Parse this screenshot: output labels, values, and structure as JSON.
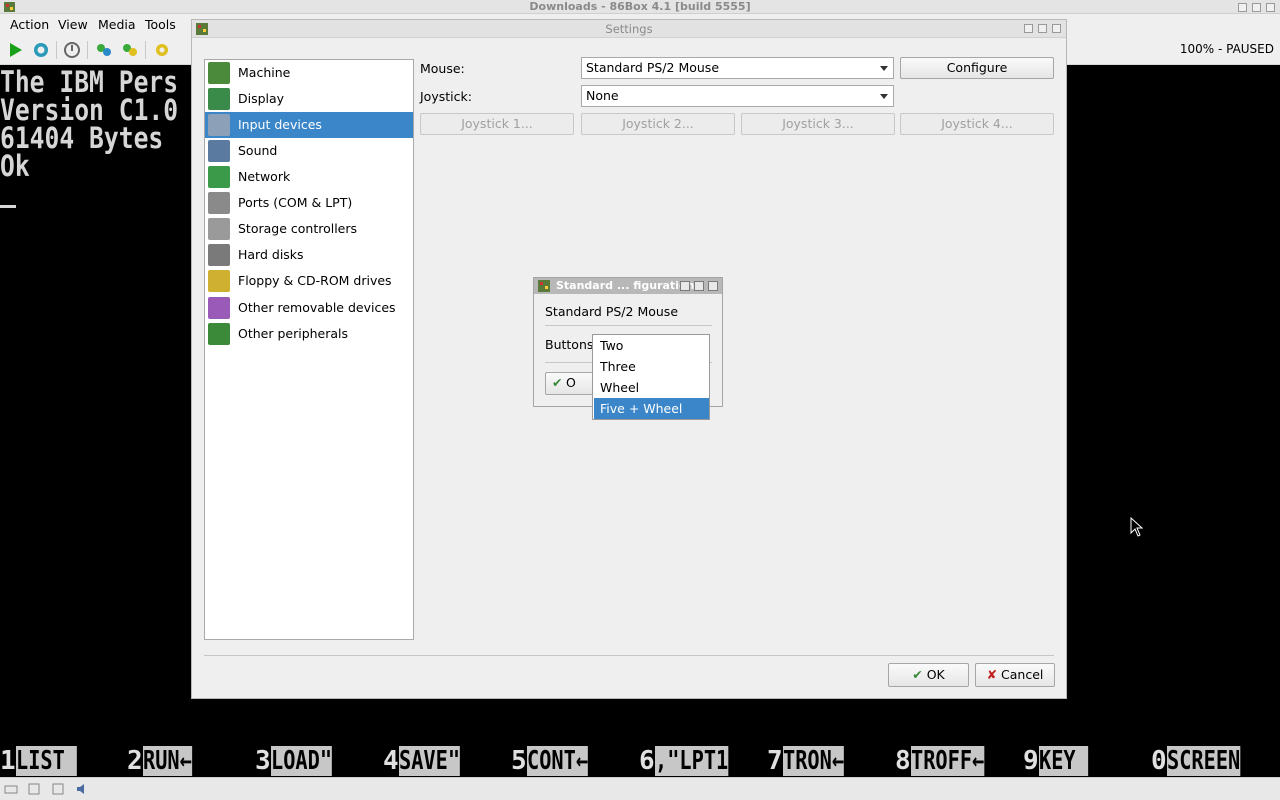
{
  "window": {
    "title": "Downloads - 86Box 4.1 [build 5555]"
  },
  "menu": [
    "Action",
    "View",
    "Media",
    "Tools"
  ],
  "toolbar": {
    "icons": [
      "play-icon",
      "reset-icon",
      "power-icon",
      "settings-icon",
      "cad-icon",
      "ctrl-alt-esc-icon"
    ],
    "zoom_status": "100% - PAUSED"
  },
  "screen": {
    "lines": [
      "The IBM Pers",
      "Version C1.0",
      "61404 Bytes",
      "Ok"
    ],
    "fkeys": [
      {
        "num": "1",
        "label": "LIST "
      },
      {
        "num": "2",
        "label": "RUN←"
      },
      {
        "num": "3",
        "label": "LOAD\""
      },
      {
        "num": "4",
        "label": "SAVE\""
      },
      {
        "num": "5",
        "label": "CONT←"
      },
      {
        "num": "6",
        "label": ",\"LPT1"
      },
      {
        "num": "7",
        "label": "TRON←"
      },
      {
        "num": "8",
        "label": "TROFF←"
      },
      {
        "num": "9",
        "label": "KEY "
      },
      {
        "num": "0",
        "label": "SCREEN"
      }
    ]
  },
  "settings": {
    "title": "Settings",
    "categories": [
      {
        "label": "Machine",
        "icon": "machine-icon",
        "color": "#4a8a3a"
      },
      {
        "label": "Display",
        "icon": "display-icon",
        "color": "#3a8a4a"
      },
      {
        "label": "Input devices",
        "icon": "input-devices-icon",
        "color": "#8ca0b8"
      },
      {
        "label": "Sound",
        "icon": "sound-icon",
        "color": "#5a7aa0"
      },
      {
        "label": "Network",
        "icon": "network-icon",
        "color": "#3a9a4a"
      },
      {
        "label": "Ports (COM & LPT)",
        "icon": "ports-icon",
        "color": "#8a8a8a"
      },
      {
        "label": "Storage controllers",
        "icon": "storage-controllers-icon",
        "color": "#9a9a9a"
      },
      {
        "label": "Hard disks",
        "icon": "hard-disks-icon",
        "color": "#7a7a7a"
      },
      {
        "label": "Floppy & CD-ROM drives",
        "icon": "floppy-cdrom-icon",
        "color": "#d0b030"
      },
      {
        "label": "Other removable devices",
        "icon": "removable-devices-icon",
        "color": "#9a5ab8"
      },
      {
        "label": "Other peripherals",
        "icon": "peripherals-icon",
        "color": "#3a8a3a"
      }
    ],
    "selected_category": "Input devices",
    "mouse_label": "Mouse:",
    "mouse_value": "Standard PS/2 Mouse",
    "configure_label": "Configure",
    "joystick_label": "Joystick:",
    "joystick_value": "None",
    "joystick_buttons": [
      "Joystick 1...",
      "Joystick 2...",
      "Joystick 3...",
      "Joystick 4..."
    ],
    "ok_label": "OK",
    "cancel_label": "Cancel"
  },
  "mouse_config": {
    "title": "Standard ... figuration",
    "device_name": "Standard PS/2 Mouse",
    "buttons_label": "Buttons",
    "ok_partial": "O",
    "options": [
      "Two",
      "Three",
      "Wheel",
      "Five + Wheel"
    ],
    "selected_option": "Five + Wheel"
  },
  "accent_color": "#3a86c8"
}
